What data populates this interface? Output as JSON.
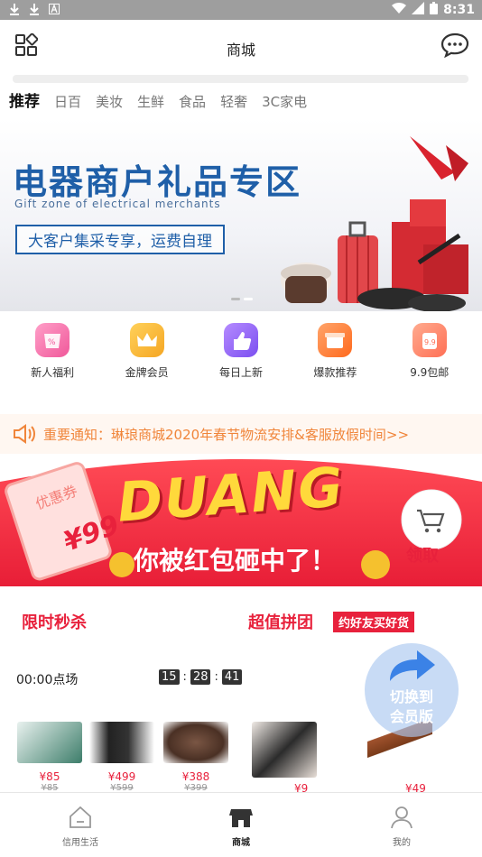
{
  "statusbar": {
    "time": "8:31"
  },
  "header": {
    "title": "商城"
  },
  "tabs": [
    {
      "label": "推荐",
      "active": true
    },
    {
      "label": "日百"
    },
    {
      "label": "美妆"
    },
    {
      "label": "生鲜"
    },
    {
      "label": "食品"
    },
    {
      "label": "轻奢"
    },
    {
      "label": "3C家电"
    }
  ],
  "banner": {
    "title": "电器商户礼品专区",
    "subtitle": "Gift zone of electrical merchants",
    "box_text": "大客户集采专享，运费自理"
  },
  "quick_icons": [
    {
      "label": "新人福利",
      "color": "#f06ba5"
    },
    {
      "label": "金牌会员",
      "color": "#f5a623"
    },
    {
      "label": "每日上新",
      "color": "#8a5cf0"
    },
    {
      "label": "爆款推荐",
      "color": "#ff7a2e"
    },
    {
      "label": "9.9包邮",
      "color": "#ff7d5a"
    }
  ],
  "notice": {
    "text": "重要通知：琳琅商城2020年春节物流安排&客服放假时间>>"
  },
  "promo": {
    "coupon_label": "优惠券",
    "coupon_value": "¥99",
    "headline": "DUANG",
    "message": "你被红包砸中了！",
    "claim": "领取"
  },
  "sections": {
    "flash_sale": "限时秒杀",
    "group_buy": "超值拼团",
    "group_buy_tag": "约好友买好货",
    "round": "00:00点场",
    "timer": {
      "h": "15",
      "m": "28",
      "s": "41"
    }
  },
  "products": [
    {
      "price": "¥85",
      "old": "¥85"
    },
    {
      "price": "¥499",
      "old": "¥599"
    },
    {
      "price": "¥388",
      "old": "¥399"
    },
    {
      "price": "¥9"
    },
    {
      "price": "¥49"
    }
  ],
  "member_float": {
    "line1": "切换到",
    "line2": "会员版"
  },
  "bottom_nav": [
    {
      "label": "信用生活"
    },
    {
      "label": "商城",
      "active": true
    },
    {
      "label": "我的"
    }
  ]
}
